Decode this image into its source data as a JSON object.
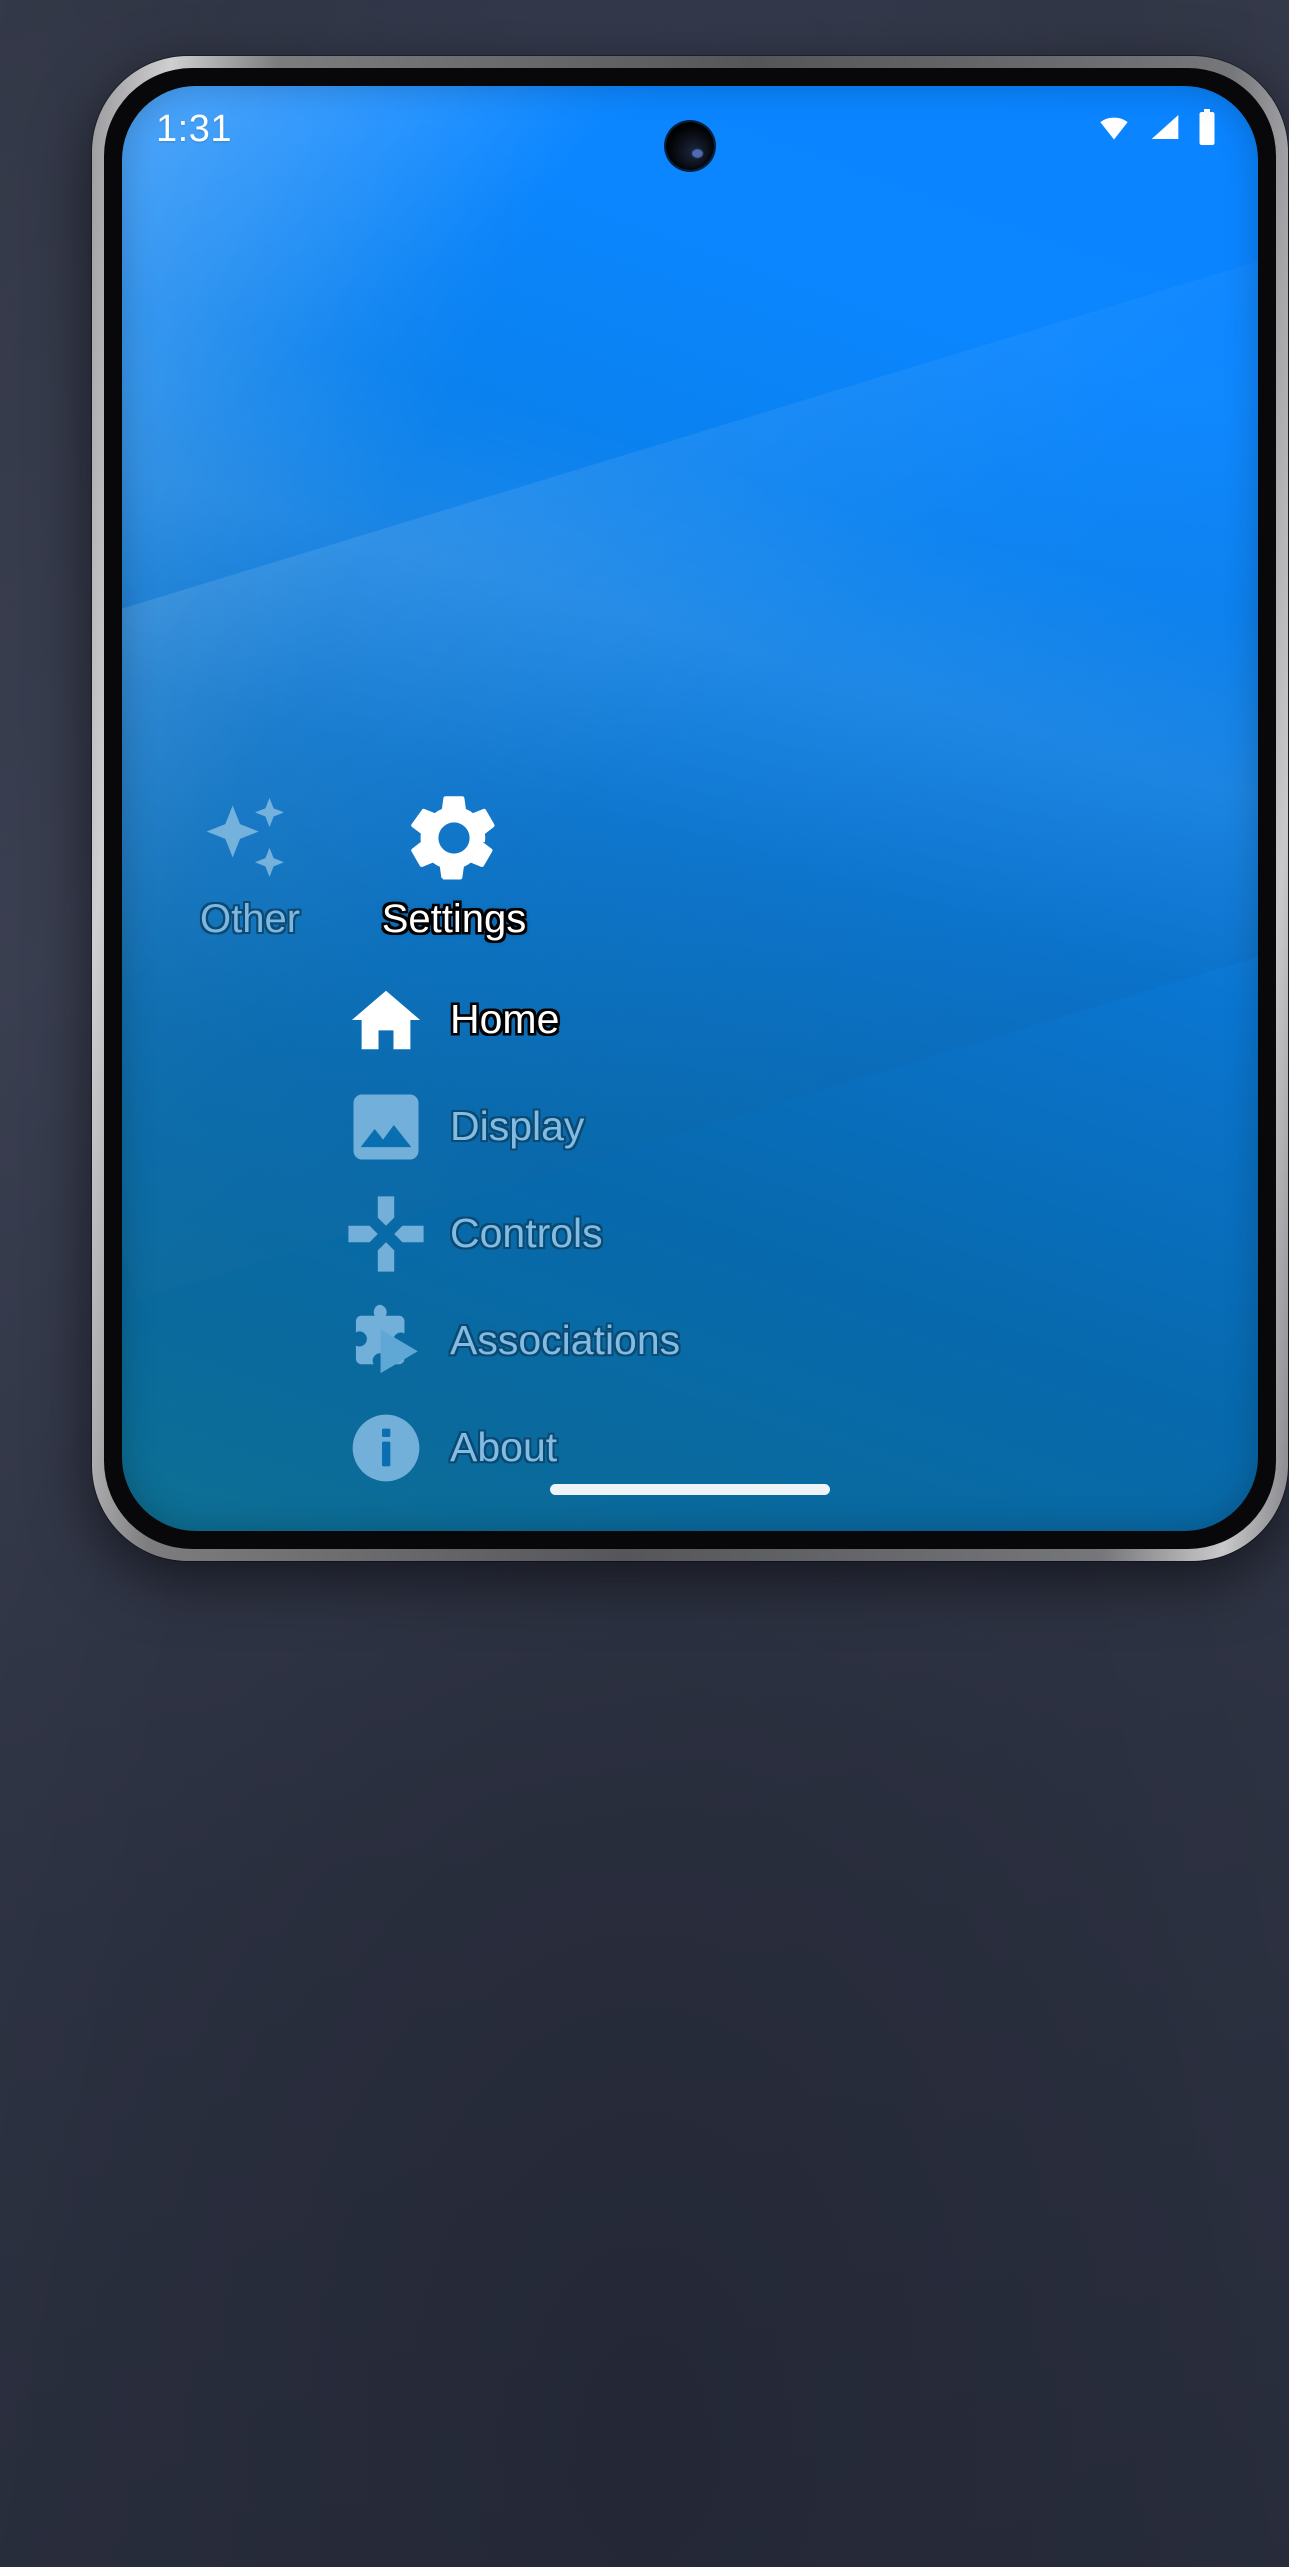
{
  "statusbar": {
    "clock": "1:31",
    "icons": [
      {
        "name": "wifi-icon",
        "label": "wifi"
      },
      {
        "name": "cellular-signal-icon",
        "label": "cellular signal"
      },
      {
        "name": "battery-icon",
        "label": "battery"
      }
    ]
  },
  "categories": [
    {
      "id": "other",
      "label": "Other",
      "icon": "sparkles-icon",
      "state": "inactive"
    },
    {
      "id": "settings",
      "label": "Settings",
      "icon": "gear-icon",
      "state": "active"
    }
  ],
  "menu": {
    "items": [
      {
        "id": "home",
        "label": "Home",
        "icon": "home-icon",
        "state": "active"
      },
      {
        "id": "display",
        "label": "Display",
        "icon": "image-icon",
        "state": "inactive"
      },
      {
        "id": "controls",
        "label": "Controls",
        "icon": "dpad-icon",
        "state": "inactive"
      },
      {
        "id": "associations",
        "label": "Associations",
        "icon": "puzzle-play-icon",
        "state": "inactive"
      },
      {
        "id": "about",
        "label": "About",
        "icon": "info-circle-icon",
        "state": "inactive"
      }
    ]
  },
  "navigation": {
    "gesture_pill": "home gesture pill"
  },
  "colors": {
    "wallpaper_top": "#0a84ff",
    "wallpaper_bottom": "#0e7093",
    "active_text": "#ffffff",
    "inactive_text": "#83bbe2",
    "text_outline": "#000000",
    "device_frame": "#55565a"
  }
}
